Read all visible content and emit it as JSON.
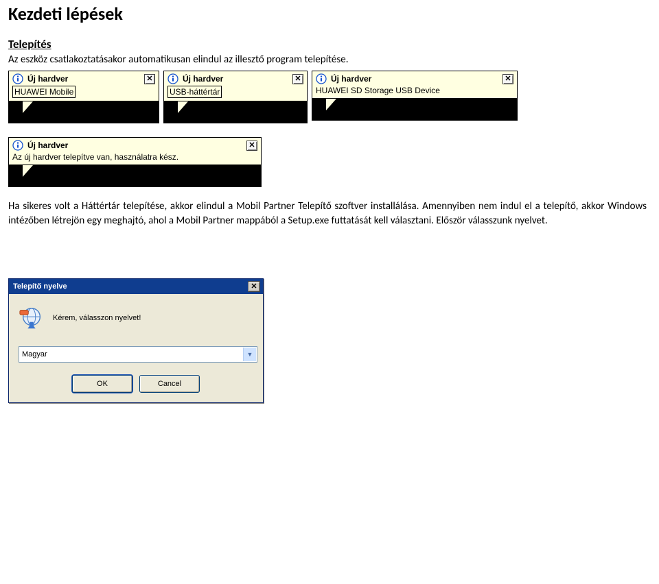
{
  "heading": "Kezdeti lépések",
  "section1": {
    "title": "Telepítés",
    "p1": "Az eszköz csatlakoztatásakor automatikusan elindul az illesztő program telepítése."
  },
  "notifications": [
    {
      "title": "Új hardver",
      "body": "HUAWEI Mobile",
      "body_boxed": true
    },
    {
      "title": "Új hardver",
      "body": "USB-háttértár",
      "body_boxed": true
    },
    {
      "title": "Új hardver",
      "body": "HUAWEI SD Storage USB Device",
      "body_boxed": false
    },
    {
      "title": "Új hardver",
      "body": "Az új hardver telepítve van, használatra kész.",
      "body_boxed": false
    }
  ],
  "para2": "Ha sikeres volt a Háttértár telepítése, akkor elindul a Mobil Partner Telepítő szoftver installálása. Amennyiben nem indul el a telepítő, akkor Windows intézőben létrejön egy meghajtó, ahol a Mobil Partner mappából a Setup.exe futtatását kell választani. Először válasszunk nyelvet.",
  "dialog": {
    "title": "Telepítő nyelve",
    "prompt": "Kérem, válasszon nyelvet!",
    "selected": "Magyar",
    "ok": "OK",
    "cancel": "Cancel"
  }
}
